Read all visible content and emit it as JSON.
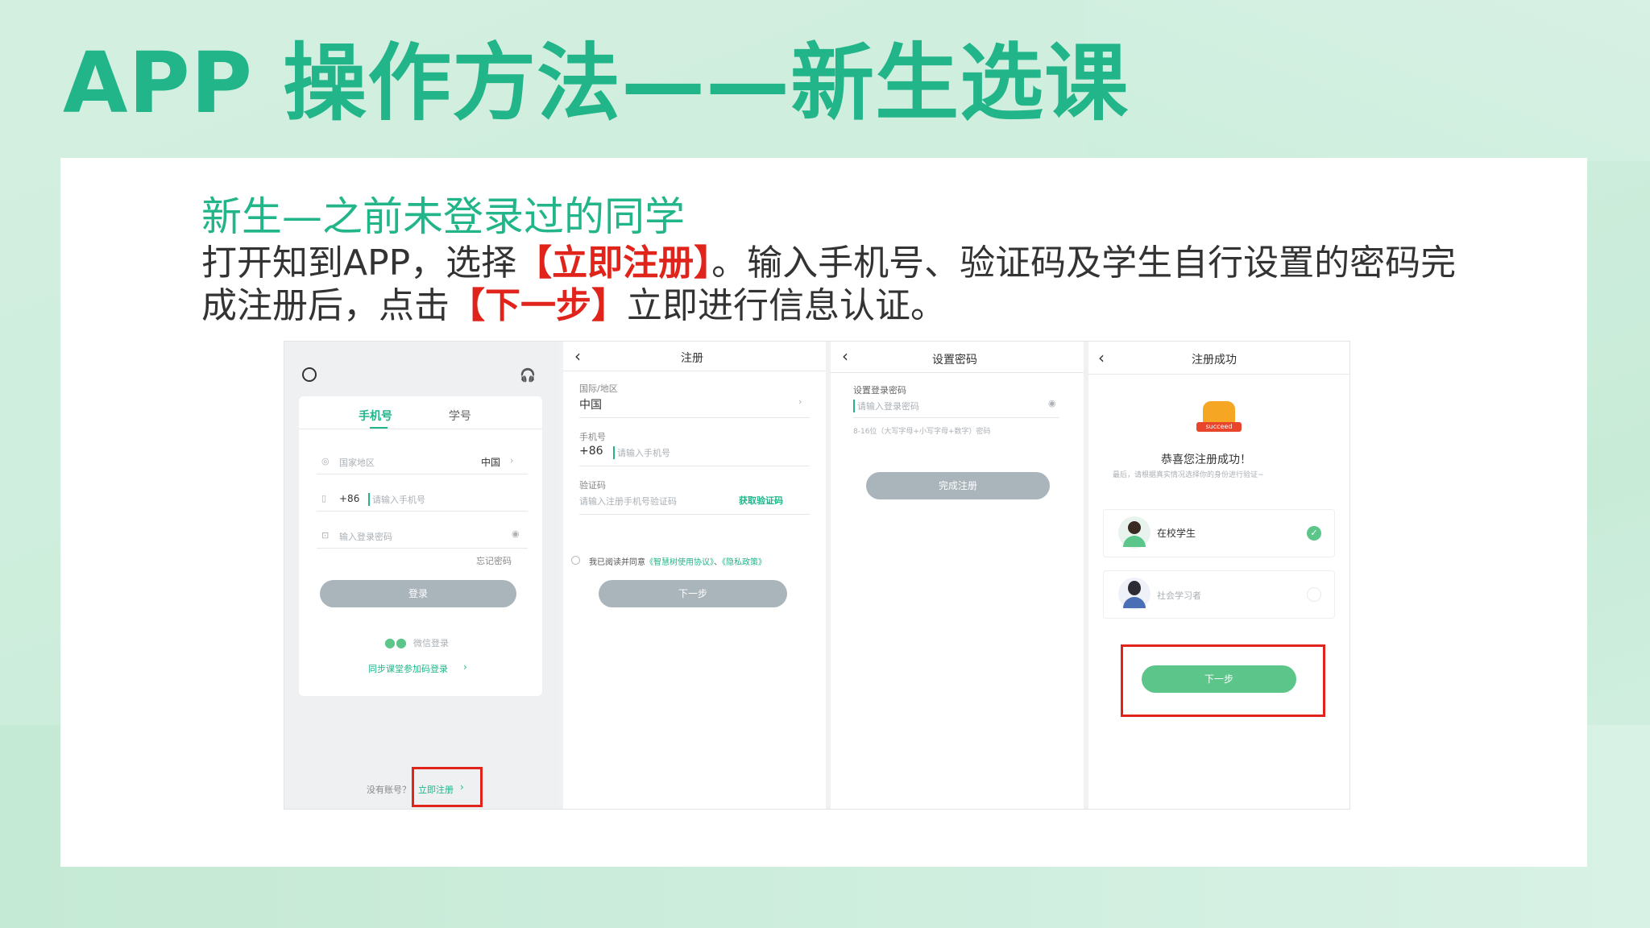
{
  "title": "APP 操作方法——新生选课",
  "subtitle": "新生—之前未登录过的同学",
  "desc": {
    "part1": "打开知到APP，选择",
    "hl1": "【立即注册】",
    "part2": "。输入手机号、验证码及学生自行设置的密码完成注册后，点击",
    "hl2": "【下一步】",
    "part3": "立即进行信息认证。"
  },
  "phone1": {
    "tab_phone": "手机号",
    "tab_student_id": "学号",
    "region_placeholder": "国家地区",
    "region_value": "中国",
    "country_code": "+86",
    "phone_placeholder": "请输入手机号",
    "password_placeholder": "输入登录密码",
    "forgot": "忘记密码",
    "login": "登录",
    "wechat_login": "微信登录",
    "class_code_login": "同步课堂参加码登录",
    "no_account": "没有账号？",
    "register": "立即注册"
  },
  "phone2": {
    "nav_title": "注册",
    "region_label": "国际/地区",
    "region_value": "中国",
    "phone_label": "手机号",
    "country_code": "+86",
    "phone_placeholder": "请输入手机号",
    "code_label": "验证码",
    "code_placeholder": "请输入注册手机号验证码",
    "get_code": "获取验证码",
    "agree_prefix": "我已阅读并同意",
    "agreement": "《智慧树使用协议》",
    "sep": "、",
    "privacy": "《隐私政策》",
    "next": "下一步"
  },
  "phone3": {
    "nav_title": "设置密码",
    "pw_label": "设置登录密码",
    "pw_placeholder": "请输入登录密码",
    "pw_hint": "8-16位（大写字母+小写字母+数字）密码",
    "finish": "完成注册"
  },
  "phone4": {
    "nav_title": "注册成功",
    "badge": "succeed",
    "congrats": "恭喜您注册成功！",
    "hint": "最后，请根据真实情况选择你的身份进行验证~",
    "role1": "在校学生",
    "role2": "社会学习者",
    "next": "下一步"
  },
  "colors": {
    "brand": "#22b58a",
    "highlight": "#e0241b",
    "button_green": "#5cc68a",
    "button_gray": "#aab4bb"
  }
}
